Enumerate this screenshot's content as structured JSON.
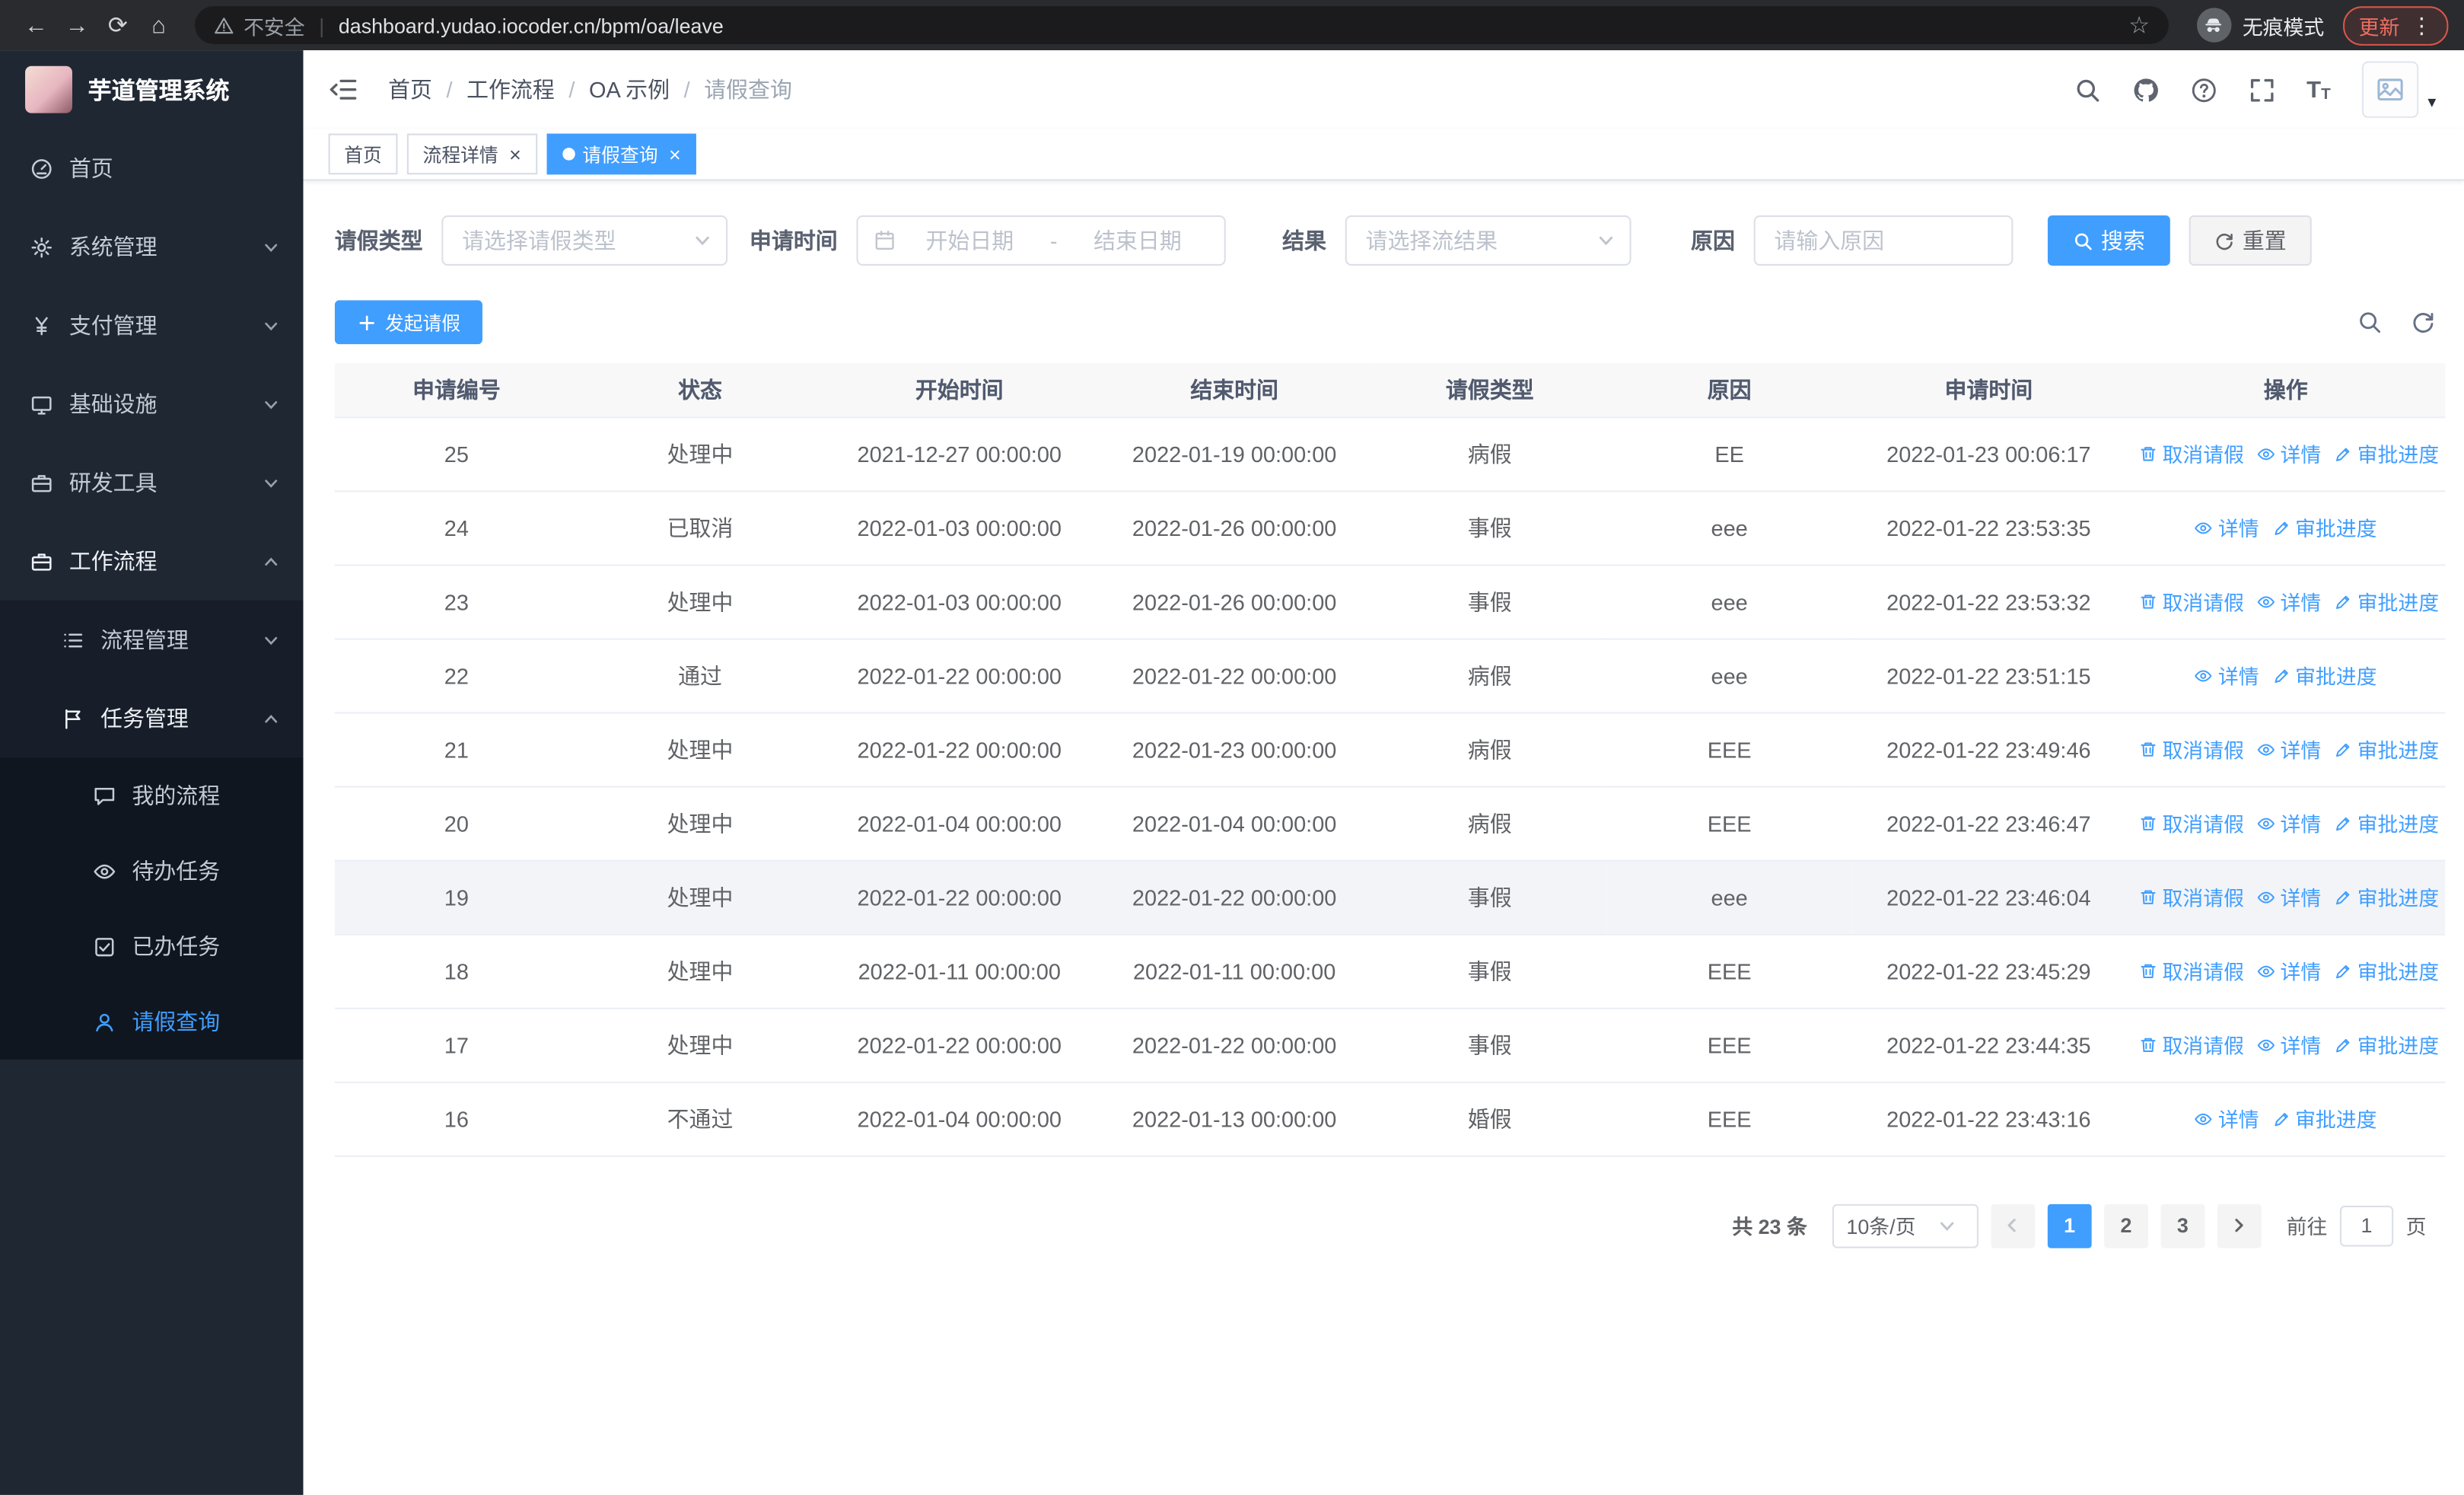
{
  "browser": {
    "security_warning": "不安全",
    "url": "dashboard.yudao.iocoder.cn/bpm/oa/leave",
    "incognito_label": "无痕模式",
    "update_button": "更新"
  },
  "sidebar": {
    "app_title": "芋道管理系统",
    "items": [
      {
        "label": "首页",
        "icon": "home-icon",
        "level": 1
      },
      {
        "label": "系统管理",
        "icon": "gear-icon",
        "level": 1,
        "chevron": "down"
      },
      {
        "label": "支付管理",
        "icon": "yen-icon",
        "level": 1,
        "chevron": "down"
      },
      {
        "label": "基础设施",
        "icon": "monitor-icon",
        "level": 1,
        "chevron": "down"
      },
      {
        "label": "研发工具",
        "icon": "tools-icon",
        "level": 1,
        "chevron": "down"
      },
      {
        "label": "工作流程",
        "icon": "workflow-icon",
        "level": 1,
        "chevron": "up",
        "expanded": true
      },
      {
        "label": "流程管理",
        "icon": "list-icon",
        "level": 2,
        "chevron": "down"
      },
      {
        "label": "任务管理",
        "icon": "task-icon",
        "level": 2,
        "chevron": "up",
        "expanded": true
      },
      {
        "label": "我的流程",
        "icon": "chat-icon",
        "level": 3
      },
      {
        "label": "待办任务",
        "icon": "eye-icon",
        "level": 3
      },
      {
        "label": "已办任务",
        "icon": "done-icon",
        "level": 3
      },
      {
        "label": "请假查询",
        "icon": "user-icon",
        "level": 3,
        "active": true
      }
    ]
  },
  "header": {
    "breadcrumb": [
      "首页",
      "工作流程",
      "OA 示例",
      "请假查询"
    ]
  },
  "tabs": [
    {
      "label": "首页",
      "closable": false,
      "active": false
    },
    {
      "label": "流程详情",
      "closable": true,
      "active": false
    },
    {
      "label": "请假查询",
      "closable": true,
      "active": true
    }
  ],
  "filters": {
    "leave_type": {
      "label": "请假类型",
      "placeholder": "请选择请假类型"
    },
    "apply_time": {
      "label": "申请时间",
      "start_placeholder": "开始日期",
      "separator": "-",
      "end_placeholder": "结束日期"
    },
    "result": {
      "label": "结果",
      "placeholder": "请选择流结果"
    },
    "reason": {
      "label": "原因",
      "placeholder": "请输入原因"
    },
    "search_button": "搜索",
    "reset_button": "重置"
  },
  "toolbar": {
    "create_button": "发起请假"
  },
  "table": {
    "columns": [
      "申请编号",
      "状态",
      "开始时间",
      "结束时间",
      "请假类型",
      "原因",
      "申请时间",
      "操作"
    ],
    "action_labels": {
      "cancel": "取消请假",
      "detail": "详情",
      "progress": "审批进度"
    },
    "rows": [
      {
        "id": "25",
        "status": "处理中",
        "start": "2021-12-27 00:00:00",
        "end": "2022-01-19 00:00:00",
        "type": "病假",
        "reason": "EE",
        "applied": "2022-01-23 00:06:17",
        "actions": [
          "cancel",
          "detail",
          "progress"
        ]
      },
      {
        "id": "24",
        "status": "已取消",
        "start": "2022-01-03 00:00:00",
        "end": "2022-01-26 00:00:00",
        "type": "事假",
        "reason": "eee",
        "applied": "2022-01-22 23:53:35",
        "actions": [
          "detail",
          "progress"
        ]
      },
      {
        "id": "23",
        "status": "处理中",
        "start": "2022-01-03 00:00:00",
        "end": "2022-01-26 00:00:00",
        "type": "事假",
        "reason": "eee",
        "applied": "2022-01-22 23:53:32",
        "actions": [
          "cancel",
          "detail",
          "progress"
        ]
      },
      {
        "id": "22",
        "status": "通过",
        "start": "2022-01-22 00:00:00",
        "end": "2022-01-22 00:00:00",
        "type": "病假",
        "reason": "eee",
        "applied": "2022-01-22 23:51:15",
        "actions": [
          "detail",
          "progress"
        ]
      },
      {
        "id": "21",
        "status": "处理中",
        "start": "2022-01-22 00:00:00",
        "end": "2022-01-23 00:00:00",
        "type": "病假",
        "reason": "EEE",
        "applied": "2022-01-22 23:49:46",
        "actions": [
          "cancel",
          "detail",
          "progress"
        ]
      },
      {
        "id": "20",
        "status": "处理中",
        "start": "2022-01-04 00:00:00",
        "end": "2022-01-04 00:00:00",
        "type": "病假",
        "reason": "EEE",
        "applied": "2022-01-22 23:46:47",
        "actions": [
          "cancel",
          "detail",
          "progress"
        ]
      },
      {
        "id": "19",
        "status": "处理中",
        "start": "2022-01-22 00:00:00",
        "end": "2022-01-22 00:00:00",
        "type": "事假",
        "reason": "eee",
        "applied": "2022-01-22 23:46:04",
        "actions": [
          "cancel",
          "detail",
          "progress"
        ],
        "hover": true
      },
      {
        "id": "18",
        "status": "处理中",
        "start": "2022-01-11 00:00:00",
        "end": "2022-01-11 00:00:00",
        "type": "事假",
        "reason": "EEE",
        "applied": "2022-01-22 23:45:29",
        "actions": [
          "cancel",
          "detail",
          "progress"
        ]
      },
      {
        "id": "17",
        "status": "处理中",
        "start": "2022-01-22 00:00:00",
        "end": "2022-01-22 00:00:00",
        "type": "事假",
        "reason": "EEE",
        "applied": "2022-01-22 23:44:35",
        "actions": [
          "cancel",
          "detail",
          "progress"
        ]
      },
      {
        "id": "16",
        "status": "不通过",
        "start": "2022-01-04 00:00:00",
        "end": "2022-01-13 00:00:00",
        "type": "婚假",
        "reason": "EEE",
        "applied": "2022-01-22 23:43:16",
        "actions": [
          "detail",
          "progress"
        ]
      }
    ]
  },
  "pagination": {
    "total_text": "共 23 条",
    "page_size": "10条/页",
    "pages": [
      "1",
      "2",
      "3"
    ],
    "active_page": "1",
    "goto_label": "前往",
    "goto_value": "1",
    "goto_suffix": "页"
  },
  "colors": {
    "primary": "#409eff",
    "sidebar_bg": "#1f2733",
    "chrome_bg": "#2a2b2e",
    "update_red": "#e8594a"
  }
}
